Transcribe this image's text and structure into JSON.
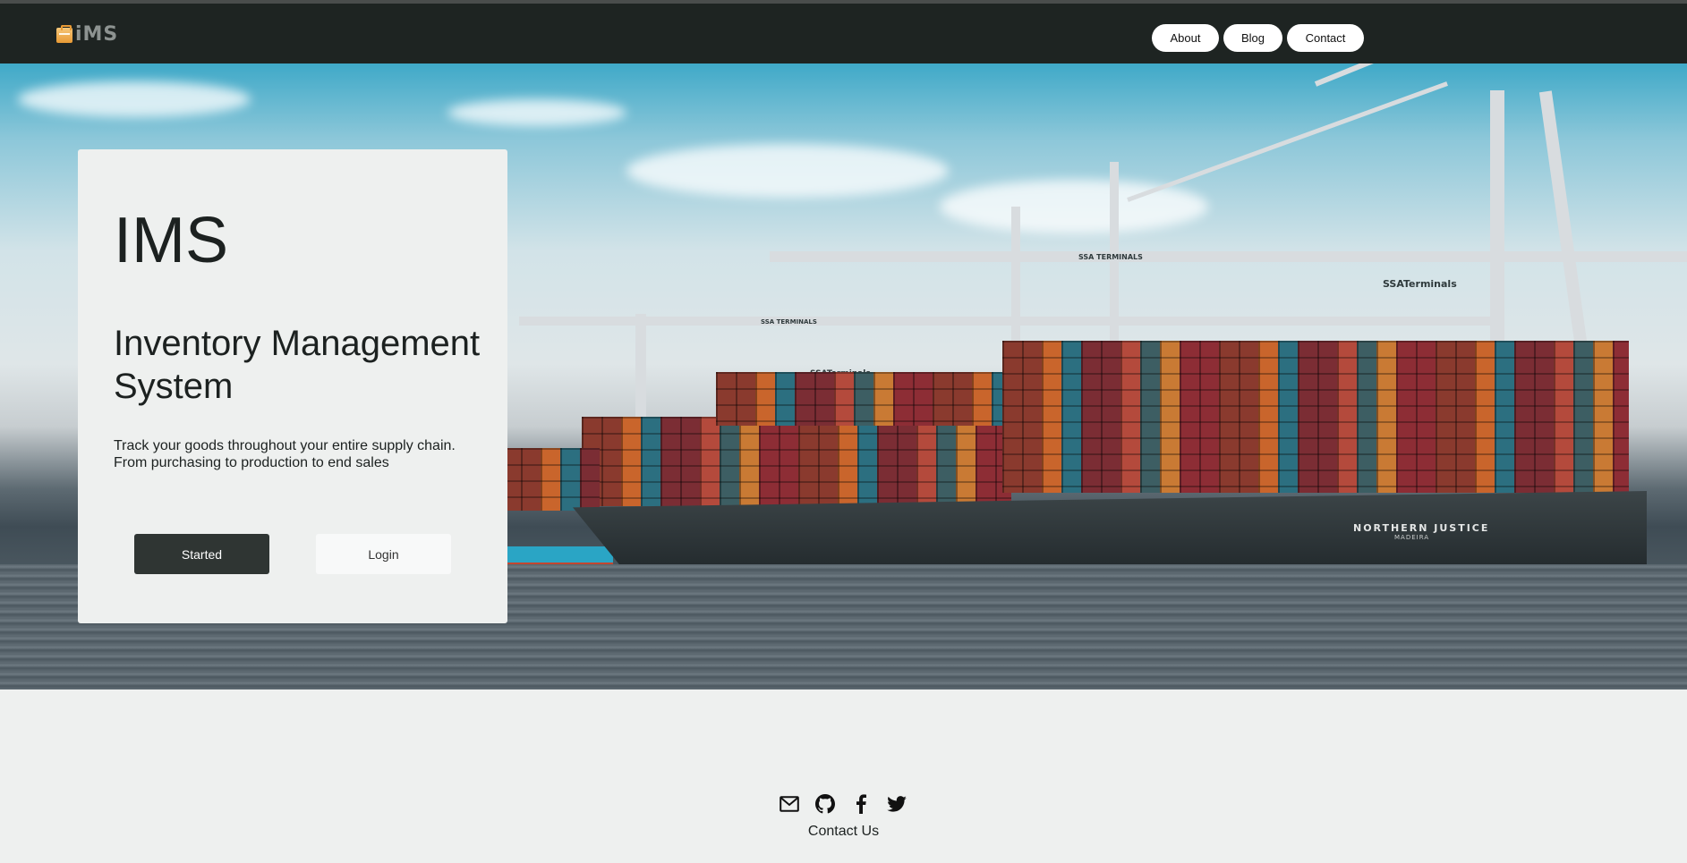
{
  "brand": {
    "logo_text": "iMS",
    "logo_icon": "briefcase-icon"
  },
  "nav": {
    "about": "About",
    "blog": "Blog",
    "contact": "Contact"
  },
  "hero": {
    "ship_name": "NORTHERN JUSTICE",
    "ship_port": "MADEIRA",
    "crane_sign_1": "SSA TERMINALS",
    "crane_sign_2": "SSATerminals",
    "crane_sign_3": "SSA TERMINALS",
    "crane_sign_4": "SSATerminals"
  },
  "card": {
    "title": "IMS",
    "subtitle": "Inventory Management System",
    "description_line1": "Track your goods throughout your entire supply chain.",
    "description_line2": "From purchasing to production to end sales",
    "started_button": "Started",
    "login_button": "Login"
  },
  "footer": {
    "icons": [
      "mail-icon",
      "github-icon",
      "facebook-icon",
      "twitter-icon"
    ],
    "contact_label": "Contact Us"
  },
  "colors": {
    "navbar": "#1e2422",
    "primary_button": "#2f3533",
    "page_background": "#eef0ef",
    "logo_accent": "#e89a35"
  }
}
